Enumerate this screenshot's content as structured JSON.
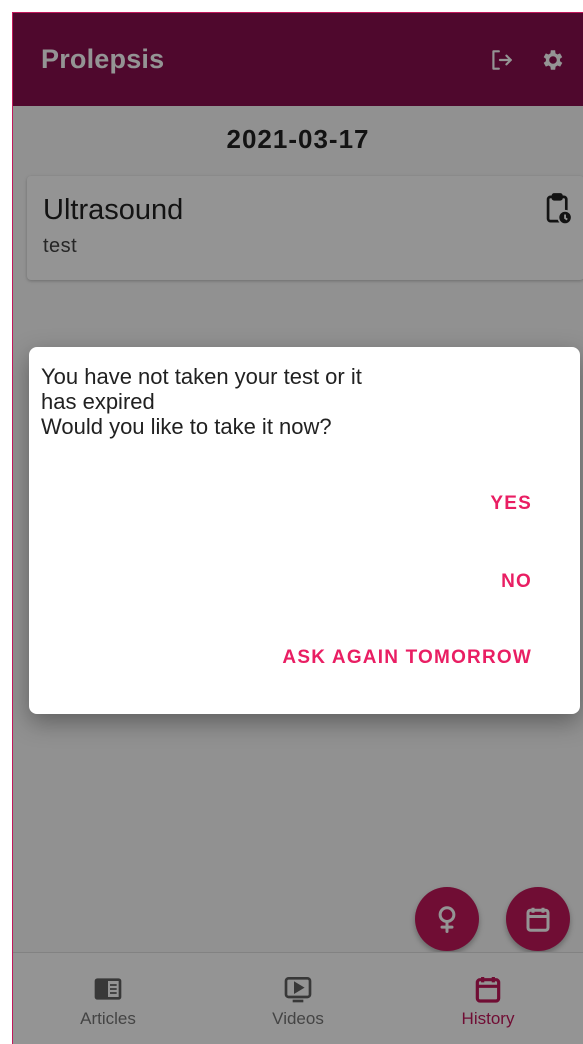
{
  "app_bar": {
    "title": "Prolepsis",
    "icons": [
      "logout-icon",
      "settings-icon"
    ]
  },
  "history": {
    "date": "2021-03-17",
    "entries": [
      {
        "title": "Ultrasound",
        "subtitle": "test",
        "icon": "clipboard-clock-icon"
      }
    ]
  },
  "fabs": [
    "female-icon",
    "calendar-icon"
  ],
  "dialog": {
    "message_lines": [
      "You have not taken your test or it",
      "has expired",
      "Would you like to take it now?"
    ],
    "actions": {
      "yes": "YES",
      "no": "NO",
      "ask_again": "ASK AGAIN TOMORROW"
    }
  },
  "bottom_nav": {
    "items": [
      {
        "label": "Articles",
        "icon": "articles-icon",
        "active": false
      },
      {
        "label": "Videos",
        "icon": "video-icon",
        "active": false
      },
      {
        "label": "History",
        "icon": "calendar-icon",
        "active": true
      }
    ]
  },
  "colors": {
    "primary": "#880e4f",
    "accent": "#c2185b",
    "dialog_action": "#e91e63",
    "scrim": "rgba(0,0,0,0.42)"
  }
}
